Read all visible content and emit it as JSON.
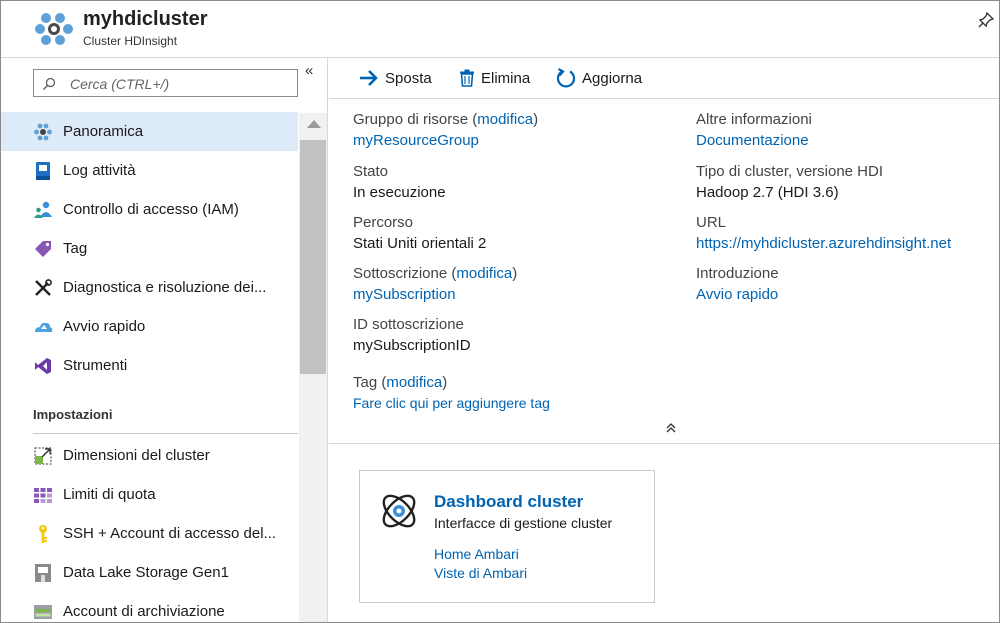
{
  "header": {
    "title": "myhdicluster",
    "subtitle": "Cluster HDInsight"
  },
  "sidebar": {
    "search_placeholder": "Cerca (CTRL+/)",
    "collapse_glyph": "«",
    "items": [
      {
        "label": "Panoramica",
        "icon": "overview-icon",
        "active": true
      },
      {
        "label": "Log attività",
        "icon": "activity-log-icon"
      },
      {
        "label": "Controllo di accesso (IAM)",
        "icon": "iam-icon"
      },
      {
        "label": "Tag",
        "icon": "tag-icon"
      },
      {
        "label": "Diagnostica e risoluzione dei...",
        "icon": "diagnose-icon"
      },
      {
        "label": "Avvio rapido",
        "icon": "quickstart-icon"
      },
      {
        "label": "Strumenti",
        "icon": "tools-icon"
      }
    ],
    "section_title": "Impostazioni",
    "settings_items": [
      {
        "label": "Dimensioni del cluster",
        "icon": "cluster-size-icon"
      },
      {
        "label": "Limiti di quota",
        "icon": "quota-icon"
      },
      {
        "label": "SSH + Account di accesso del...",
        "icon": "key-icon"
      },
      {
        "label": "Data Lake Storage Gen1",
        "icon": "datalake-icon"
      },
      {
        "label": "Account di archiviazione",
        "icon": "storage-icon"
      }
    ]
  },
  "toolbar": {
    "move_label": "Sposta",
    "delete_label": "Elimina",
    "refresh_label": "Aggiorna"
  },
  "essentials": {
    "resource_group_label": "Gruppo di risorse",
    "resource_group_edit": "modifica",
    "resource_group_value": "myResourceGroup",
    "status_label": "Stato",
    "status_value": "In esecuzione",
    "location_label": "Percorso",
    "location_value": "Stati Uniti orientali 2",
    "subscription_label": "Sottoscrizione",
    "subscription_edit": "modifica",
    "subscription_value": "mySubscription",
    "subscription_id_label": "ID sottoscrizione",
    "subscription_id_value": "mySubscriptionID",
    "more_info_label": "Altre informazioni",
    "more_info_value": "Documentazione",
    "cluster_type_label": "Tipo di cluster, versione HDI",
    "cluster_type_value": "Hadoop 2.7 (HDI 3.6)",
    "url_label": "URL",
    "url_value": "https://myhdicluster.azurehdinsight.net",
    "intro_label": "Introduzione",
    "intro_value": "Avvio rapido",
    "tags_label": "Tag",
    "tags_edit": "modifica",
    "tags_add": "Fare clic qui per aggiungere tag",
    "collapse_glyph": "⌃"
  },
  "card": {
    "title": "Dashboard cluster",
    "subtitle": "Interfacce di gestione cluster",
    "link1": "Home Ambari",
    "link2": "Viste di Ambari"
  },
  "colors": {
    "link": "#0063b1",
    "active_bg": "#ddebf8"
  }
}
